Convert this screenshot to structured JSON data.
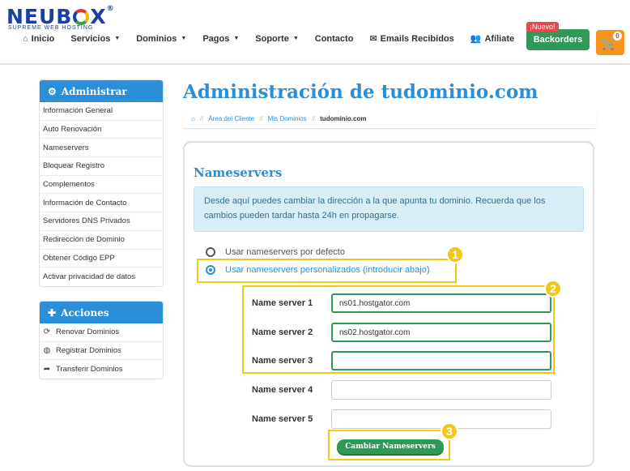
{
  "header": {
    "logo_text": "NEUB",
    "logo_text_end": "X",
    "tagline": "SUPREME WEB HOSTING",
    "nav": [
      {
        "label": "Inicio",
        "icon": "home-icon"
      },
      {
        "label": "Servicios",
        "dropdown": true
      },
      {
        "label": "Dominios",
        "dropdown": true
      },
      {
        "label": "Pagos",
        "dropdown": true
      },
      {
        "label": "Soporte",
        "dropdown": true
      },
      {
        "label": "Contacto"
      },
      {
        "label": "Emails Recibidos",
        "icon": "envelope-icon"
      },
      {
        "label": "Afíliate",
        "icon": "users-icon"
      }
    ],
    "new_badge": "¡Nuevo!",
    "backorders_label": "Backorders",
    "cart_count": "0"
  },
  "sidebar": {
    "admin_title": "Administrar",
    "admin_items": [
      "Información General",
      "Auto Renovación",
      "Nameservers",
      "Bloquear Registro",
      "Complementos",
      "Información de Contacto",
      "Servidores DNS Privados",
      "Redirección de Dominio",
      "Obtener Código EPP",
      "Activar privacidad de datos"
    ],
    "actions_title": "Acciones",
    "action_items": [
      {
        "label": "Renovar Dominios",
        "icon": "refresh-icon"
      },
      {
        "label": "Registrar Dominios",
        "icon": "globe-icon"
      },
      {
        "label": "Transferir Dominios",
        "icon": "share-icon"
      }
    ]
  },
  "main": {
    "title": "Administración de tudominio.com",
    "breadcrumb": [
      "Área del Cliente",
      "Mis Dominios",
      "tudominio.com"
    ],
    "card_title": "Nameservers",
    "info_text": "Desde aquí puedes cambiar la dirección a la que apunta tu dominio. Recuerda que los cambios pueden tardar hasta 24h en propagarse.",
    "radio_default": "Usar nameservers por defecto",
    "radio_custom": "Usar nameservers personalizados (introducir abajo)",
    "nameservers": [
      {
        "label": "Name server 1",
        "value": "ns01.hostgator.com"
      },
      {
        "label": "Name server 2",
        "value": "ns02.hostgator.com"
      },
      {
        "label": "Name server 3",
        "value": ""
      },
      {
        "label": "Name server 4",
        "value": ""
      },
      {
        "label": "Name server 5",
        "value": ""
      }
    ],
    "submit_label": "Cambiar Nameservers"
  },
  "annotations": [
    "1",
    "2",
    "3"
  ],
  "colors": {
    "accent": "#2b8ed8",
    "green": "#2f9a55",
    "highlight": "#f2c71a",
    "cart": "#f7941d"
  }
}
